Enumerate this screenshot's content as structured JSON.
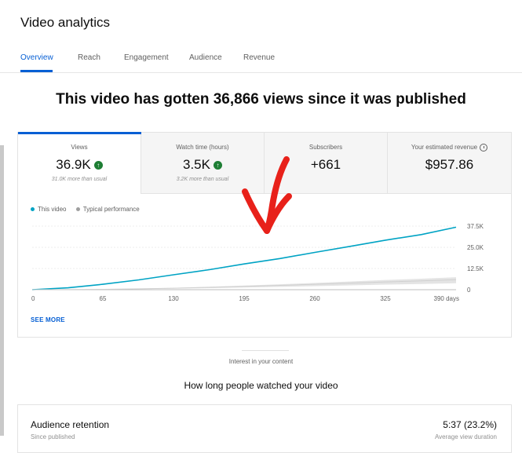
{
  "header": {
    "title": "Video analytics"
  },
  "tabs": [
    {
      "label": "Overview",
      "active": true
    },
    {
      "label": "Reach",
      "active": false
    },
    {
      "label": "Engagement",
      "active": false
    },
    {
      "label": "Audience",
      "active": false
    },
    {
      "label": "Revenue",
      "active": false
    }
  ],
  "headline": "This video has gotten 36,866 views since it was published",
  "metrics": [
    {
      "label": "Views",
      "value": "36.9K",
      "sub": "31.0K more than usual",
      "trend_icon": "arrow-up-icon"
    },
    {
      "label": "Watch time (hours)",
      "value": "3.5K",
      "sub": "3.2K more than usual",
      "trend_icon": "arrow-up-icon"
    },
    {
      "label": "Subscribers",
      "value": "+661"
    },
    {
      "label": "Your estimated revenue",
      "value": "$957.86",
      "info_icon": "info-icon"
    }
  ],
  "chart_data": {
    "type": "line",
    "x": [
      0,
      33,
      65,
      98,
      130,
      163,
      195,
      228,
      260,
      293,
      325,
      358,
      390
    ],
    "series": [
      {
        "name": "This video",
        "color": "#00a3c4",
        "values": [
          0,
          1100,
          3200,
          5800,
          8800,
          11800,
          15200,
          18400,
          22000,
          25600,
          29200,
          32500,
          36866
        ]
      },
      {
        "name": "Typical performance",
        "color": "#9e9e9e",
        "values": [
          0,
          80,
          230,
          500,
          900,
          1400,
          1950,
          2550,
          3200,
          3900,
          4600,
          5200,
          5900
        ]
      }
    ],
    "xticks": [
      0,
      65,
      130,
      195,
      260,
      325,
      390
    ],
    "xtick_labels": [
      "0",
      "65",
      "130",
      "195",
      "260",
      "325",
      "390 days"
    ],
    "yticks": [
      0,
      12500,
      25000,
      37500
    ],
    "ytick_labels": [
      "0",
      "12.5K",
      "25.0K",
      "37.5K"
    ],
    "xlim": [
      0,
      390
    ],
    "ylim": [
      0,
      37500
    ],
    "grid": true,
    "legend": "top-left"
  },
  "see_more": "SEE MORE",
  "section": {
    "label": "Interest in your content",
    "title": "How long people watched your video"
  },
  "retention": {
    "title": "Audience retention",
    "sub": "Since published",
    "value": "5:37 (23.2%)",
    "value_sub": "Average view duration"
  },
  "colors": {
    "accent": "#065fd4",
    "line": "#00a3c4",
    "typical": "#9e9e9e",
    "arrow": "#e8211a",
    "up": "#1e7e34"
  }
}
